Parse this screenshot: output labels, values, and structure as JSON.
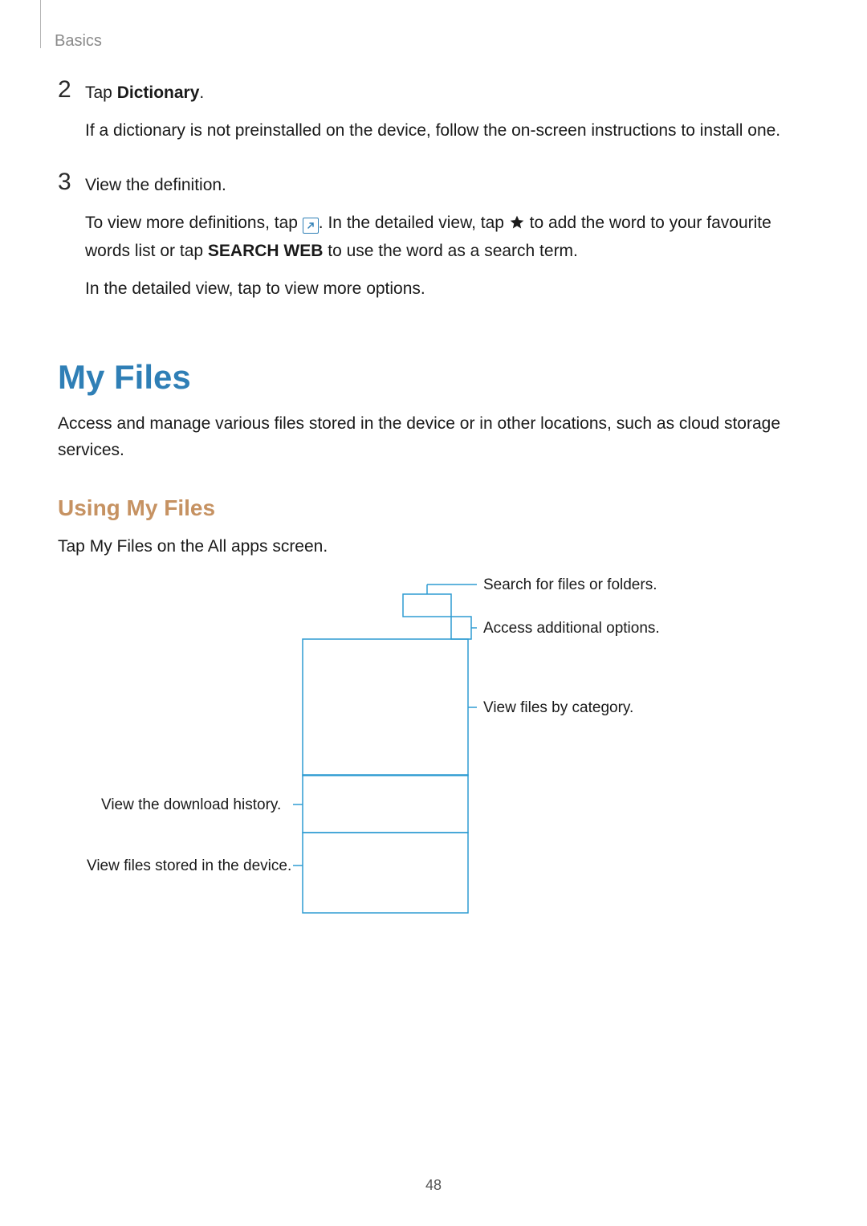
{
  "header": {
    "section": "Basics"
  },
  "steps": {
    "s2": {
      "num": "2",
      "line1_pre": "Tap ",
      "line1_bold": "Dictionary",
      "line1_post": ".",
      "line2": "If a dictionary is not preinstalled on the device, follow the on-screen instructions to install one."
    },
    "s3": {
      "num": "3",
      "line1": "View the definition.",
      "line2_a": "To view more definitions, tap ",
      "line2_b": ". In the detailed view, tap ",
      "line2_c": " to add the word to your favourite words list or tap ",
      "line2_bold": "SEARCH WEB",
      "line2_d": " to use the word as a search term.",
      "line3": "In the detailed view, tap   to view more options."
    }
  },
  "myfiles": {
    "title": "My Files",
    "intro": "Access and manage various files stored in the device or in other locations, such as cloud storage services.",
    "subheading": "Using My Files",
    "instruction_pre": "Tap ",
    "instruction_bold": "My Files",
    "instruction_post": " on the All apps screen."
  },
  "callouts": {
    "search": "Search for files or folders.",
    "options": "Access additional options.",
    "category": "View files by category.",
    "download": "View the download history.",
    "stored": "View files stored in the device."
  },
  "page_number": "48"
}
